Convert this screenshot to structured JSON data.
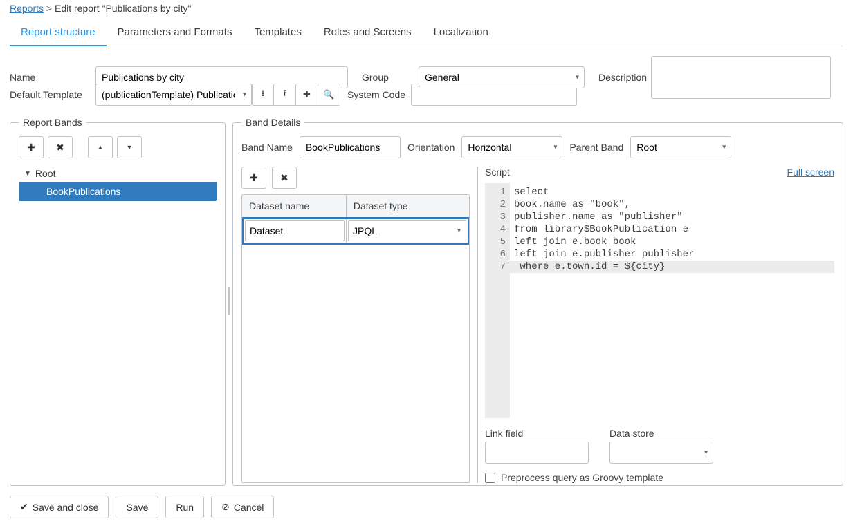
{
  "breadcrumb": {
    "root": "Reports",
    "current": "Edit report \"Publications by city\""
  },
  "tabs": {
    "structure": "Report structure",
    "params": "Parameters and Formats",
    "templates": "Templates",
    "roles": "Roles and Screens",
    "localization": "Localization"
  },
  "form": {
    "name_label": "Name",
    "name_value": "Publications by city",
    "group_label": "Group",
    "group_value": "General",
    "description_label": "Description",
    "description_value": "",
    "default_template_label": "Default Template",
    "default_template_value": "(publicationTemplate) Publication",
    "system_code_label": "System Code",
    "system_code_value": ""
  },
  "report_bands": {
    "legend": "Report Bands",
    "root": "Root",
    "items": [
      "BookPublications"
    ]
  },
  "band_details": {
    "legend": "Band Details",
    "band_name_label": "Band Name",
    "band_name_value": "BookPublications",
    "orientation_label": "Orientation",
    "orientation_value": "Horizontal",
    "parent_band_label": "Parent Band",
    "parent_band_value": "Root",
    "dataset_name_header": "Dataset name",
    "dataset_type_header": "Dataset type",
    "dataset_name_value": "Dataset",
    "dataset_type_value": "JPQL",
    "script_label": "Script",
    "full_screen": "Full screen",
    "script_lines": [
      "select",
      "book.name as \"book\",",
      "publisher.name as \"publisher\"",
      "from library$BookPublication e",
      "left join e.book book",
      "left join e.publisher publisher",
      " where e.town.id = ${city}"
    ],
    "link_field_label": "Link field",
    "link_field_value": "",
    "data_store_label": "Data store",
    "data_store_value": "",
    "preprocess_label": "Preprocess query as Groovy template"
  },
  "footer": {
    "save_close": "Save and close",
    "save": "Save",
    "run": "Run",
    "cancel": "Cancel"
  },
  "icons": {
    "plus": "✚",
    "times": "✖",
    "up": "▲",
    "down": "▼",
    "caret": "▾",
    "download": "⭳",
    "upload": "⭱",
    "search": "🔍",
    "check": "✔",
    "ban": "⊘",
    "tree_caret": "▼"
  }
}
